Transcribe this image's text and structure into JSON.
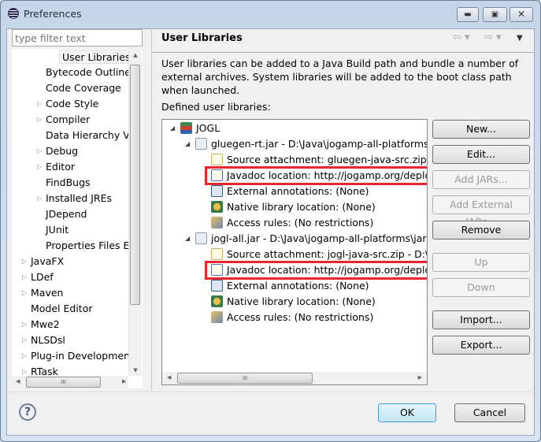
{
  "window": {
    "title": "Preferences",
    "icon": "eclipse-icon",
    "controls": [
      "minimize",
      "maximize",
      "close"
    ]
  },
  "filter": {
    "placeholder": "type filter text",
    "value": ""
  },
  "left_tree": {
    "items": [
      {
        "label": "User Libraries",
        "level": 2,
        "expandable": false,
        "selected": true
      },
      {
        "label": "Bytecode Outline",
        "level": 2,
        "expandable": false
      },
      {
        "label": "Code Coverage",
        "level": 2,
        "expandable": false
      },
      {
        "label": "Code Style",
        "level": 2,
        "expandable": true
      },
      {
        "label": "Compiler",
        "level": 2,
        "expandable": true
      },
      {
        "label": "Data Hierarchy Vie",
        "level": 2,
        "expandable": false
      },
      {
        "label": "Debug",
        "level": 2,
        "expandable": true
      },
      {
        "label": "Editor",
        "level": 2,
        "expandable": true
      },
      {
        "label": "FindBugs",
        "level": 2,
        "expandable": false
      },
      {
        "label": "Installed JREs",
        "level": 2,
        "expandable": true
      },
      {
        "label": "JDepend",
        "level": 2,
        "expandable": false
      },
      {
        "label": "JUnit",
        "level": 2,
        "expandable": false
      },
      {
        "label": "Properties Files Ed",
        "level": 2,
        "expandable": false
      },
      {
        "label": "JavaFX",
        "level": 1,
        "expandable": true
      },
      {
        "label": "LDef",
        "level": 1,
        "expandable": true
      },
      {
        "label": "Maven",
        "level": 1,
        "expandable": true
      },
      {
        "label": "Model Editor",
        "level": 1,
        "expandable": false
      },
      {
        "label": "Mwe2",
        "level": 1,
        "expandable": true
      },
      {
        "label": "NLSDsl",
        "level": 1,
        "expandable": true
      },
      {
        "label": "Plug-in Development",
        "level": 1,
        "expandable": true
      },
      {
        "label": "RTask",
        "level": 1,
        "expandable": true
      }
    ]
  },
  "page": {
    "title": "User Libraries",
    "description": "User libraries can be added to a Java Build path and bundle a number of external archives. System libraries will be added to the boot class path when launched.",
    "defined_label": "Defined user libraries:"
  },
  "lib_tree": {
    "items": [
      {
        "label": "JOGL",
        "level": 0,
        "icon": "library-icon",
        "expanded": true
      },
      {
        "label": "gluegen-rt.jar - D:\\Java\\jogamp-all-platforms\\jar",
        "level": 1,
        "icon": "jar-icon",
        "expanded": true
      },
      {
        "label": "Source attachment: gluegen-java-src.zip - D:\\Java",
        "level": 2,
        "icon": "source-icon"
      },
      {
        "label": "Javadoc location: http://jogamp.org/deployment",
        "level": 2,
        "icon": "javadoc-icon",
        "highlighted": true
      },
      {
        "label": "External annotations: (None)",
        "level": 2,
        "icon": "annotations-icon"
      },
      {
        "label": "Native library location: (None)",
        "level": 2,
        "icon": "native-library-icon"
      },
      {
        "label": "Access rules: (No restrictions)",
        "level": 2,
        "icon": "access-rules-icon"
      },
      {
        "label": "jogl-all.jar - D:\\Java\\jogamp-all-platforms\\jar",
        "level": 1,
        "icon": "jar-icon",
        "expanded": true
      },
      {
        "label": "Source attachment: jogl-java-src.zip - D:\\Java",
        "level": 2,
        "icon": "source-icon"
      },
      {
        "label": "Javadoc location: http://jogamp.org/deployment",
        "level": 2,
        "icon": "javadoc-icon",
        "highlighted": true
      },
      {
        "label": "External annotations: (None)",
        "level": 2,
        "icon": "annotations-icon"
      },
      {
        "label": "Native library location: (None)",
        "level": 2,
        "icon": "native-library-icon"
      },
      {
        "label": "Access rules: (No restrictions)",
        "level": 2,
        "icon": "access-rules-icon"
      }
    ]
  },
  "buttons": {
    "new": "New...",
    "edit": "Edit...",
    "add_jars": "Add JARs...",
    "add_external_jars": "Add External JARs...",
    "remove": "Remove",
    "up": "Up",
    "down": "Down",
    "import": "Import...",
    "export": "Export...",
    "ok": "OK",
    "cancel": "Cancel"
  },
  "colors": {
    "highlight_box": "#e8262d",
    "ok_focus": "#3c9fd8"
  }
}
